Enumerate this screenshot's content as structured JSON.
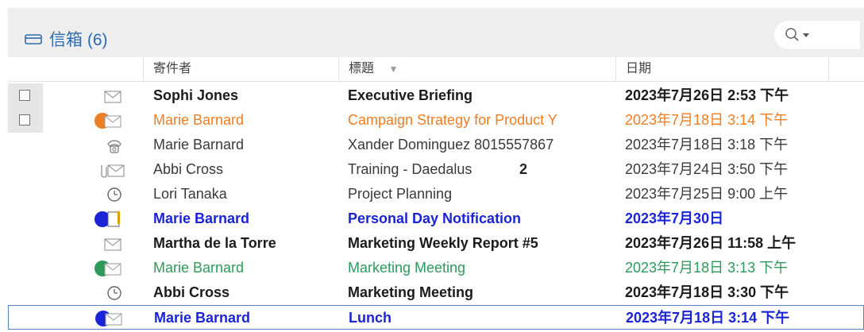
{
  "header": {
    "title": "信箱 (6)",
    "search_icon": "search-icon"
  },
  "columns": {
    "sender": "寄件者",
    "subject": "標題",
    "date": "日期"
  },
  "messages": [
    {
      "sender": "Sophi Jones",
      "subject": "Executive Briefing",
      "date": "2023年7月26日 2:53 下午",
      "icon": "envelope-icon",
      "style": "bold"
    },
    {
      "sender": "Marie Barnard",
      "subject": "Campaign Strategy for Product Y",
      "date": "2023年7月18日 3:14 下午",
      "icon": "orange-category-envelope-icon",
      "style": "orange"
    },
    {
      "sender": "Marie Barnard",
      "subject": "Xander Dominguez 8015557867",
      "date": "2023年7月18日 3:18 下午",
      "icon": "phone-icon",
      "style": "normal"
    },
    {
      "sender": "Abbi Cross",
      "subject": "Training - Daedalus",
      "date": "2023年7月24日 3:50 下午",
      "icon": "attachment-envelope-icon",
      "style": "normal",
      "badge": "2"
    },
    {
      "sender": "Lori Tanaka",
      "subject": "Project Planning",
      "date": "2023年7月25日 9:00 上午",
      "icon": "clock-icon",
      "style": "normal"
    },
    {
      "sender": "Marie Barnard",
      "subject": "Personal Day Notification",
      "date": "2023年7月30日",
      "icon": "blue-category-note-icon",
      "style": "blue"
    },
    {
      "sender": "Martha de la Torre",
      "subject": "Marketing Weekly Report #5",
      "date": "2023年7月26日 11:58 上午",
      "icon": "envelope-icon",
      "style": "bold"
    },
    {
      "sender": "Marie Barnard",
      "subject": "Marketing Meeting",
      "date": "2023年7月18日 3:13 下午",
      "icon": "green-category-envelope-icon",
      "style": "green"
    },
    {
      "sender": "Abbi Cross",
      "subject": "Marketing Meeting",
      "date": "2023年7月18日 3:30 下午",
      "icon": "clock-icon",
      "style": "bold"
    },
    {
      "sender": "Marie Barnard",
      "subject": "Lunch",
      "date": "2023年7月18日 3:14 下午",
      "icon": "blue-category-envelope-icon",
      "style": "blue",
      "selected": true
    }
  ],
  "colors": {
    "accent": "#2b6cb0",
    "orange": "#ef7d22",
    "blue": "#1a24d6",
    "green": "#2e9a5a",
    "selection_border": "#5b7fc8"
  }
}
